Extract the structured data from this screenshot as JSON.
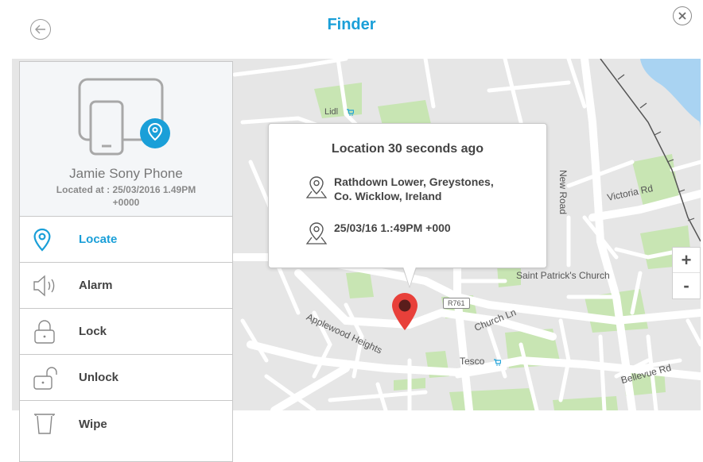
{
  "header": {
    "title": "Finder"
  },
  "device": {
    "name": "Jamie Sony Phone",
    "located_line1": "Located at : 25/03/2016 1.49PM",
    "located_line2": "+0000"
  },
  "menu": [
    {
      "label": "Locate",
      "icon": "location-pin-icon",
      "active": true
    },
    {
      "label": "Alarm",
      "icon": "speaker-icon",
      "active": false
    },
    {
      "label": "Lock",
      "icon": "lock-icon",
      "active": false
    },
    {
      "label": "Unlock",
      "icon": "unlock-icon",
      "active": false
    },
    {
      "label": "Wipe",
      "icon": "bucket-icon",
      "active": false
    }
  ],
  "popup": {
    "title": "Location 30 seconds ago",
    "address_line1": "Rathdown Lower, Greystones,",
    "address_line2": "Co. Wicklow, Ireland",
    "time": "25/03/16  1.:49PM +000"
  },
  "map": {
    "labels": {
      "lidl": "Lidl",
      "tesco": "Tesco",
      "new_road": "New Road",
      "victoria_rd": "Victoria Rd",
      "saint_patricks": "Saint Patrick's Church",
      "applewood": "Applewood Heights",
      "church_ln": "Church Ln",
      "bellevue": "Bellevue Rd",
      "r761": "R761"
    },
    "zoom_in": "+",
    "zoom_out": "-"
  },
  "colors": {
    "accent": "#1a9fd8",
    "marker": "#e8403a",
    "park": "#c8e5b3",
    "water": "#a9d3f2"
  }
}
